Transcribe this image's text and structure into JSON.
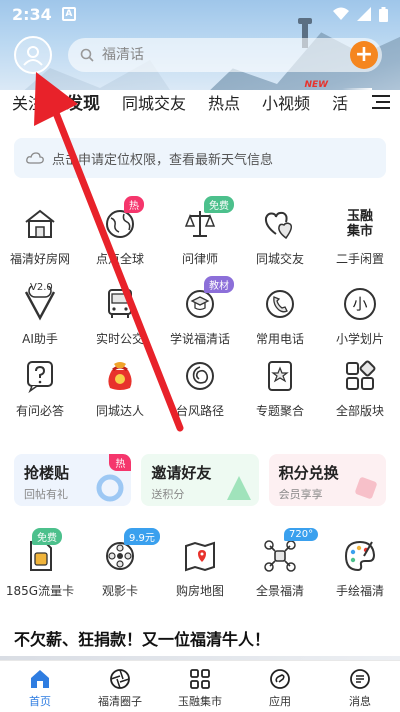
{
  "status_bar": {
    "time": "2:34",
    "app_icon_letter": "A"
  },
  "search": {
    "placeholder": "福清话"
  },
  "tabs": [
    {
      "label": "关注"
    },
    {
      "label": "发现"
    },
    {
      "label": "同城交友"
    },
    {
      "label": "热点"
    },
    {
      "label": "小视频",
      "badge": "NEW"
    },
    {
      "label": "活"
    }
  ],
  "weather": {
    "text": "点击申请定位权限，查看最新天气信息"
  },
  "grid_row1": [
    {
      "label": "福清好房网"
    },
    {
      "label": "点点全球",
      "tag": "热"
    },
    {
      "label": "问律师",
      "tag": "免费"
    },
    {
      "label": "同城交友"
    },
    {
      "label": "二手闲置",
      "icon_text": "玉融集市"
    }
  ],
  "grid_row2": [
    {
      "label": "AI助手",
      "icon_text": "V2.0"
    },
    {
      "label": "实时公交"
    },
    {
      "label": "学说福清话",
      "tag": "教材"
    },
    {
      "label": "常用电话"
    },
    {
      "label": "小学划片",
      "icon_text": "小"
    }
  ],
  "grid_row3": [
    {
      "label": "有问必答"
    },
    {
      "label": "同城达人"
    },
    {
      "label": "台风路径"
    },
    {
      "label": "专题聚合"
    },
    {
      "label": "全部版块"
    }
  ],
  "promos": [
    {
      "title": "抢楼贴",
      "sub": "回帖有礼",
      "badge": "热"
    },
    {
      "title": "邀请好友",
      "sub": "送积分"
    },
    {
      "title": "积分兑换",
      "sub": "会员享享"
    }
  ],
  "grid_row4": [
    {
      "label": "185G流量卡",
      "tag": "免费"
    },
    {
      "label": "观影卡",
      "tag": "9.9元"
    },
    {
      "label": "购房地图"
    },
    {
      "label": "全景福清",
      "tag": "720°"
    },
    {
      "label": "手绘福清"
    }
  ],
  "article": {
    "title": "不欠薪、狂捐款！又一位福清牛人！"
  },
  "bottom_nav": [
    {
      "label": "首页"
    },
    {
      "label": "福清圈子"
    },
    {
      "label": "玉融集市"
    },
    {
      "label": "应用"
    },
    {
      "label": "消息"
    }
  ],
  "colors": {
    "accent": "#2f7de1",
    "orange": "#f5861f",
    "hot_tag": "#f5366c",
    "arrow": "#e8222a"
  }
}
